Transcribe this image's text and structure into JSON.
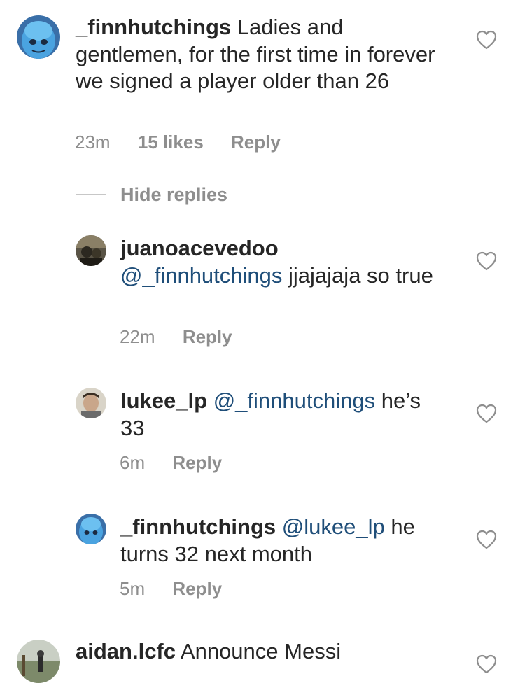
{
  "comments": [
    {
      "username": "_finnhutchings",
      "text": "Ladies and gentlemen, for the first time in forever we signed a player older than 26",
      "time": "23m",
      "likes": "15 likes",
      "reply": "Reply"
    }
  ],
  "hide_replies": "Hide replies",
  "replies": [
    {
      "username": "juanoacevedoo",
      "mention": "@_finnhutchings",
      "text": "jjajajaja so true",
      "time": "22m",
      "reply": "Reply"
    },
    {
      "username": "lukee_lp",
      "mention": "@_finnhutchings",
      "text": "he’s 33",
      "time": "6m",
      "reply": "Reply"
    },
    {
      "username": "_finnhutchings",
      "mention": "@lukee_lp",
      "text": "he turns 32 next month",
      "time": "5m",
      "reply": "Reply"
    }
  ],
  "last_comment": {
    "username": "aidan.lcfc",
    "text": "Announce Messi"
  },
  "icons": {
    "like": "heart-outline-icon",
    "avatar_megamind": "blue-character-avatar",
    "avatar_photo": "photo-avatar"
  }
}
